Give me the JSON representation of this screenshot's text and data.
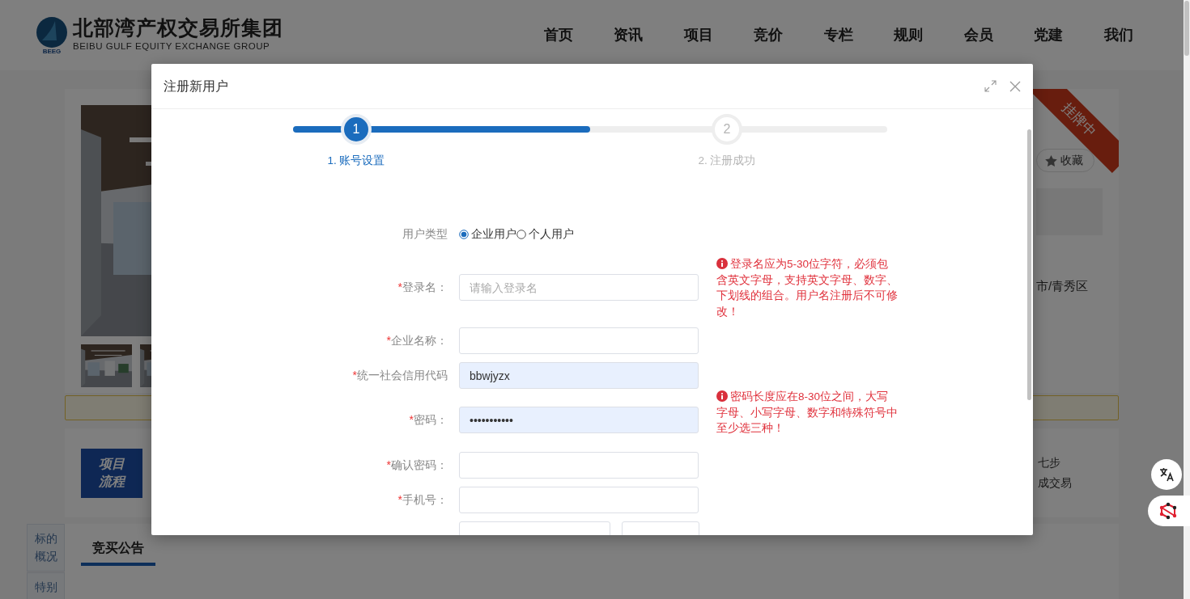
{
  "header": {
    "logo_name": "北部湾产权交易所集团",
    "logo_subtitle": "BEIBU GULF EQUITY EXCHANGE GROUP",
    "logo_mark": "BEEG",
    "nav": [
      "首页",
      "资讯",
      "项目",
      "竞价",
      "专栏",
      "规则",
      "会员",
      "党建",
      "我们"
    ]
  },
  "listing": {
    "ribbon": "挂牌中",
    "favorite": "收藏",
    "location": "市/青秀区",
    "process_badge": [
      "项目",
      "流程"
    ],
    "process_steps": [
      "七步",
      "成交易"
    ]
  },
  "tabs": {
    "side": [
      {
        "label": "标的概况"
      },
      {
        "label": "特别"
      }
    ],
    "main": [
      {
        "label": "竞买公告",
        "selected": true
      }
    ]
  },
  "dialog": {
    "title": "注册新用户",
    "progress": {
      "level": 0.5
    },
    "steps": [
      {
        "number": "1",
        "label": "1. 账号设置",
        "selected": true
      },
      {
        "number": "2",
        "label": "2. 注册成功",
        "selected": false
      }
    ],
    "fields": [
      {
        "kind": "radio",
        "label": "用户类型",
        "options": [
          {
            "label": "企业用户",
            "selected": true
          },
          {
            "label": "个人用户",
            "selected": false
          }
        ]
      },
      {
        "kind": "text",
        "mark": "*",
        "label": "登录名：",
        "placeholder": "请输入登录名",
        "autofilled": false,
        "hint": "登录名应为5-30位字符，必须包含英文字母，支持英文字母、数字、下划线的组合。用户名注册后不可修改！"
      },
      {
        "kind": "text",
        "mark": "*",
        "label": "企业名称：",
        "autofilled": false
      },
      {
        "kind": "text",
        "mark": "*",
        "label": "统一社会信用代码",
        "value": "bbwjyzx",
        "autofilled": true
      },
      {
        "kind": "text",
        "mark": "*",
        "label": "密码：",
        "value": "•••••••••••",
        "autofilled": true,
        "hint": "密码长度应在8-30位之间，大写字母、小写字母、数字和特殊符号中至少选三种！"
      },
      {
        "kind": "text",
        "mark": "*",
        "label": "确认密码：",
        "autofilled": false
      },
      {
        "kind": "text",
        "mark": "*",
        "label": "手机号：",
        "autofilled": false
      },
      {
        "kind": "captcha"
      }
    ]
  }
}
